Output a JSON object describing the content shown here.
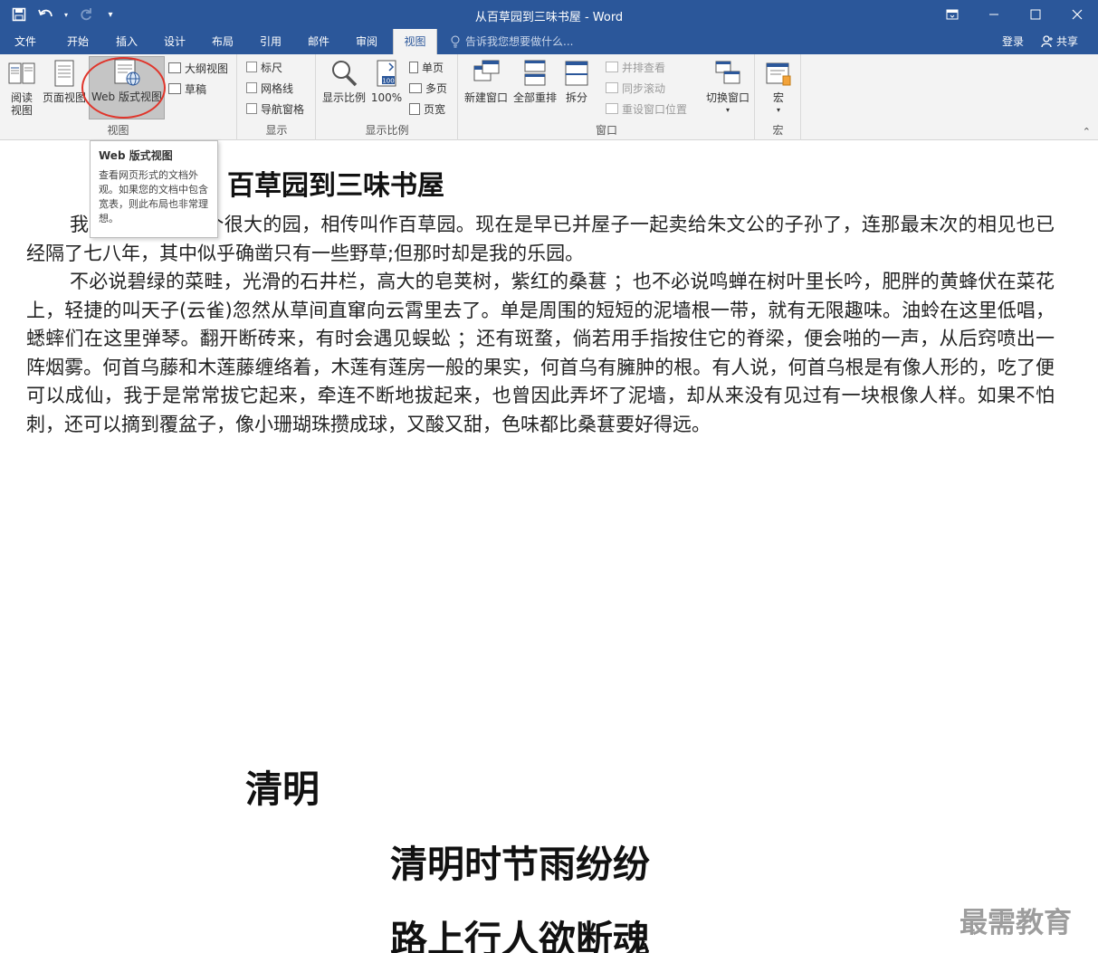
{
  "window": {
    "title": "从百草园到三味书屋 - Word",
    "controls": [
      "restore-ribbon-icon",
      "minimize-icon",
      "maximize-icon",
      "close-icon"
    ]
  },
  "qat": {
    "icons": [
      "save-icon",
      "undo-icon",
      "redo-icon",
      "customize-icon"
    ]
  },
  "tabs": [
    "文件",
    "开始",
    "插入",
    "设计",
    "布局",
    "引用",
    "邮件",
    "审阅",
    "视图"
  ],
  "active_tab": "视图",
  "tell_me": "告诉我您想要做什么...",
  "account": {
    "signin": "登录",
    "share": "共享"
  },
  "ribbon": {
    "views": {
      "label": "视图",
      "read_mode": "阅读\n视图",
      "print_layout": "页面视图",
      "web_layout": "Web 版式视图",
      "outline": "大纲视图",
      "draft": "草稿"
    },
    "show": {
      "label": "显示",
      "ruler": "标尺",
      "gridlines": "网格线",
      "nav_pane": "导航窗格"
    },
    "zoom": {
      "label": "显示比例",
      "zoom": "显示比例",
      "hundred": "100%",
      "one_page": "单页",
      "multi_page": "多页",
      "page_width": "页宽",
      "hundred_icon_text": "100"
    },
    "window": {
      "label": "窗口",
      "new_window": "新建窗口",
      "arrange_all": "全部重排",
      "split": "拆分",
      "side_by_side": "并排查看",
      "sync_scroll": "同步滚动",
      "reset_position": "重设窗口位置",
      "switch_windows": "切换窗口"
    },
    "macros": {
      "label": "宏",
      "macros": "宏"
    }
  },
  "tooltip": {
    "title": "Web 版式视图",
    "body": "查看网页形式的文档外观。如果您的文档中包含宽表，则此布局也非常理想。"
  },
  "document": {
    "heading": "百草园到三味书屋",
    "para1": "我家的后面有一个很大的园，相传叫作百草园。现在是早已并屋子一起卖给朱文公的子孙了，连那最末次的相见也已经隔了七八年，其中似乎确凿只有一些野草;但那时却是我的乐园。",
    "para2": "不必说碧绿的菜畦，光滑的石井栏，高大的皂荚树，紫红的桑葚 ；也不必说鸣蝉在树叶里长吟，肥胖的黄蜂伏在菜花上，轻捷的叫天子(云雀)忽然从草间直窜向云霄里去了。单是周围的短短的泥墙根一带，就有无限趣味。油蛉在这里低唱，蟋蟀们在这里弹琴。翻开断砖来，有时会遇见蜈蚣 ；还有斑蝥，倘若用手指按住它的脊梁，便会啪的一声，从后窍喷出一阵烟雾。何首乌藤和木莲藤缠络着，木莲有莲房一般的果实，何首乌有臃肿的根。有人说，何首乌根是有像人形的，吃了便可以成仙，我于是常常拔它起来，牵连不断地拔起来，也曾因此弄坏了泥墙，却从来没有见过有一块根像人样。如果不怕刺，还可以摘到覆盆子，像小珊瑚珠攒成球，又酸又甜，色味都比桑葚要好得远。",
    "poem_title": "清明",
    "poem_line1": "清明时节雨纷纷",
    "poem_line2": "路上行人欲断魂"
  },
  "watermark": "最需教育",
  "colors": {
    "brand": "#2b579a",
    "ribbon_bg": "#f3f3f3",
    "annotation": "#e0352b"
  }
}
